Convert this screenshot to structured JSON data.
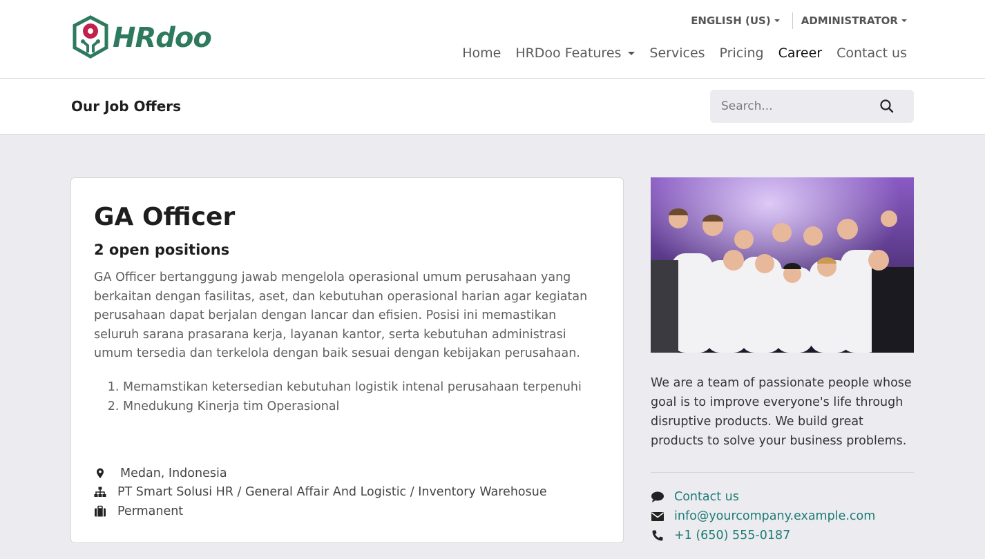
{
  "brand": {
    "name": "HRdoo",
    "wordmark": "HRdoo"
  },
  "topbar": {
    "language": "ENGLISH (US)",
    "user": "ADMINISTRATOR"
  },
  "nav": [
    {
      "label": "Home"
    },
    {
      "label": "HRDoo Features"
    },
    {
      "label": "Services"
    },
    {
      "label": "Pricing"
    },
    {
      "label": "Career"
    },
    {
      "label": "Contact us"
    }
  ],
  "subheader": {
    "title": "Our Job Offers",
    "search_placeholder": "Search..."
  },
  "job": {
    "title": "GA Officer",
    "openings": "2 open positions",
    "description": "GA Officer bertanggung jawab mengelola operasional umum perusahaan yang berkaitan dengan fasilitas, aset, dan kebutuhan operasional harian agar kegiatan perusahaan dapat berjalan dengan lancar dan efisien. Posisi ini memastikan seluruh sarana prasarana kerja, layanan kantor, serta kebutuhan administrasi umum tersedia dan terkelola dengan baik sesuai dengan kebijakan perusahaan.",
    "requirements": [
      "Memamstikan ketersedian kebutuhan logistik intenal perusahaan terpenuhi",
      "Mnedukung Kinerja tim Operasional"
    ],
    "location": "Medan, Indonesia",
    "department": "PT Smart Solusi HR / General Affair And Logistic / Inventory Warehosue",
    "employment_type": "Permanent"
  },
  "sidebar": {
    "about": "We are a team of passionate people whose goal is to improve everyone's life through disruptive products. We build great products to solve your business problems.",
    "contact_label": "Contact us",
    "email": "info@yourcompany.example.com",
    "phone": "+1 (650) 555-0187"
  },
  "colors": {
    "link": "#1c7c74",
    "brand_green": "#2d7a5f",
    "brand_red": "#c0224a",
    "page_bg": "#ecebf0"
  }
}
